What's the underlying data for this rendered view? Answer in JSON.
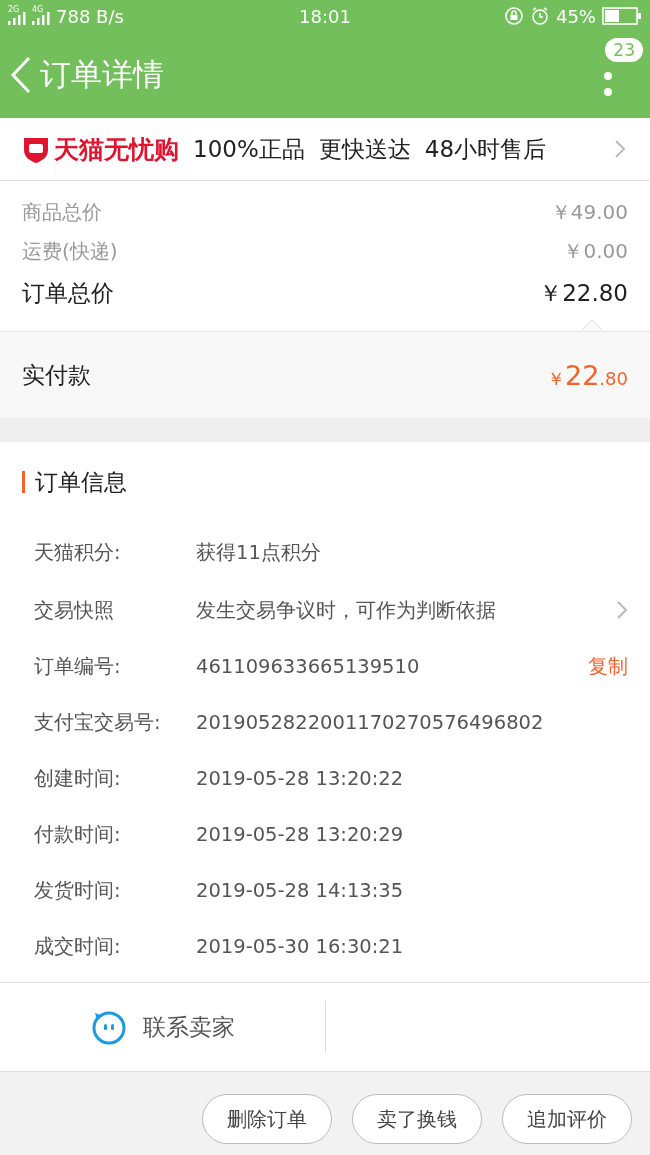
{
  "status_bar": {
    "networks": [
      "2G",
      "4G"
    ],
    "speed": "788 B/s",
    "time": "18:01",
    "battery": "45%"
  },
  "header": {
    "title": "订单详情",
    "badge": "23"
  },
  "banner": {
    "brand": "天猫无忧购",
    "points": [
      "100%正品",
      "更快送达",
      "48小时售后"
    ]
  },
  "price_rows": [
    {
      "label": "商品总价",
      "value": "￥49.00",
      "kind": "minor"
    },
    {
      "label": "运费(快递)",
      "value": "￥0.00",
      "kind": "minor"
    },
    {
      "label": "订单总价",
      "value": "￥22.80",
      "kind": "total"
    }
  ],
  "paid": {
    "label": "实付款",
    "currency": "￥",
    "integer": "22",
    "decimal": ".80"
  },
  "order_info": {
    "title": "订单信息",
    "rows": [
      {
        "label": "天猫积分:",
        "value": "获得11点积分",
        "kind": "plain"
      },
      {
        "label": "交易快照",
        "value": "发生交易争议时，可作为判断依据",
        "kind": "link"
      },
      {
        "label": "订单编号:",
        "value": "461109633665139510",
        "kind": "copy",
        "action": "复制"
      },
      {
        "label": "支付宝交易号:",
        "value": "2019052822001170270576496802",
        "kind": "plain"
      },
      {
        "label": "创建时间:",
        "value": "2019-05-28 13:20:22",
        "kind": "plain"
      },
      {
        "label": "付款时间:",
        "value": "2019-05-28 13:20:29",
        "kind": "plain"
      },
      {
        "label": "发货时间:",
        "value": "2019-05-28 14:13:35",
        "kind": "plain"
      },
      {
        "label": "成交时间:",
        "value": "2019-05-30 16:30:21",
        "kind": "plain"
      }
    ]
  },
  "contact": {
    "label": "联系卖家"
  },
  "actions": [
    "删除订单",
    "卖了换钱",
    "追加评价"
  ]
}
